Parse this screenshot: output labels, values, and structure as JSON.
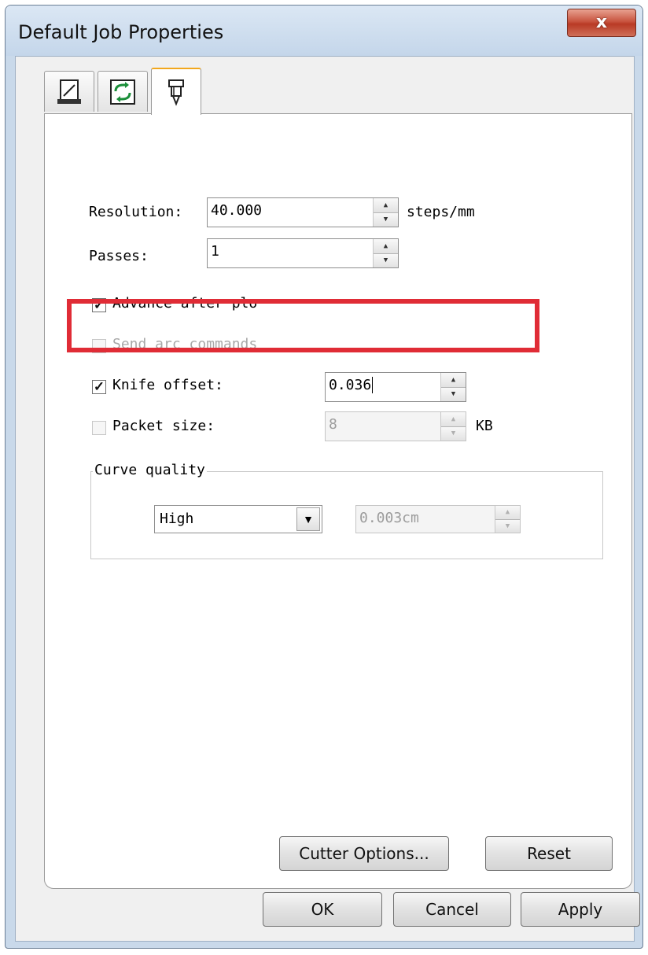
{
  "window": {
    "title": "Default Job Properties",
    "close_label": "x"
  },
  "tabs": [
    {
      "icon": "page-setup-icon",
      "active": false
    },
    {
      "icon": "rotate-icon",
      "active": false
    },
    {
      "icon": "knife-tool-icon",
      "active": true
    }
  ],
  "settings": {
    "resolution": {
      "label": "Resolution:",
      "value": "40.000",
      "unit": "steps/mm"
    },
    "passes": {
      "label": "Passes:",
      "value": "1"
    },
    "advance_after_plot": {
      "label": "Advance after plo",
      "checked": true
    },
    "send_arc_commands": {
      "label": "Send arc commands",
      "checked": false,
      "enabled": false
    },
    "knife_offset": {
      "label": "Knife offset:",
      "value": "0.036",
      "checked": true
    },
    "packet_size": {
      "label": "Packet size:",
      "value": "8",
      "unit": "KB",
      "checked": false
    }
  },
  "curve_quality": {
    "title": "Curve quality",
    "selected": "High",
    "tolerance": "0.003cm"
  },
  "buttons": {
    "cutter_options": "Cutter Options...",
    "reset": "Reset",
    "ok": "OK",
    "cancel": "Cancel",
    "apply": "Apply"
  },
  "colors": {
    "highlight": "#e02c36",
    "close_button": "#c8543f",
    "active_tab_accent": "#f2a71d"
  }
}
